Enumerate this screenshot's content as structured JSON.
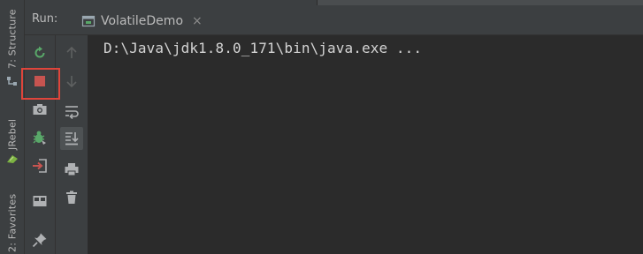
{
  "side_strip": {
    "tabs": [
      {
        "label": "7: Structure"
      },
      {
        "label": "JRebel"
      },
      {
        "label": "2: Favorites"
      }
    ]
  },
  "run_panel": {
    "label": "Run:",
    "tab": {
      "title": "VolatileDemo",
      "close_glyph": "×"
    }
  },
  "toolbar": {
    "col1": [
      {
        "name": "rerun-icon"
      },
      {
        "name": "stop-icon",
        "highlighted": true
      },
      {
        "name": "dump-threads-icon"
      },
      {
        "name": "debug-icon"
      },
      {
        "name": "exit-icon"
      },
      {
        "name": "layout-icon"
      },
      {
        "name": "pin-icon"
      }
    ],
    "col2": [
      {
        "name": "up-arrow-icon",
        "enabled": false
      },
      {
        "name": "down-arrow-icon",
        "enabled": false
      },
      {
        "name": "soft-wrap-icon"
      },
      {
        "name": "scroll-to-end-icon",
        "pressed": true
      },
      {
        "name": "print-icon"
      },
      {
        "name": "clear-all-icon"
      }
    ]
  },
  "console": {
    "lines": [
      "D:\\Java\\jdk1.8.0_171\\bin\\java.exe ..."
    ]
  },
  "colors": {
    "background": "#2B2B2B",
    "panel": "#3C3F41",
    "text": "#BBBBBB",
    "console_text": "#D4D4D4",
    "stop_red": "#C75450",
    "highlight_border": "#E0453B",
    "run_green": "#59A869"
  }
}
